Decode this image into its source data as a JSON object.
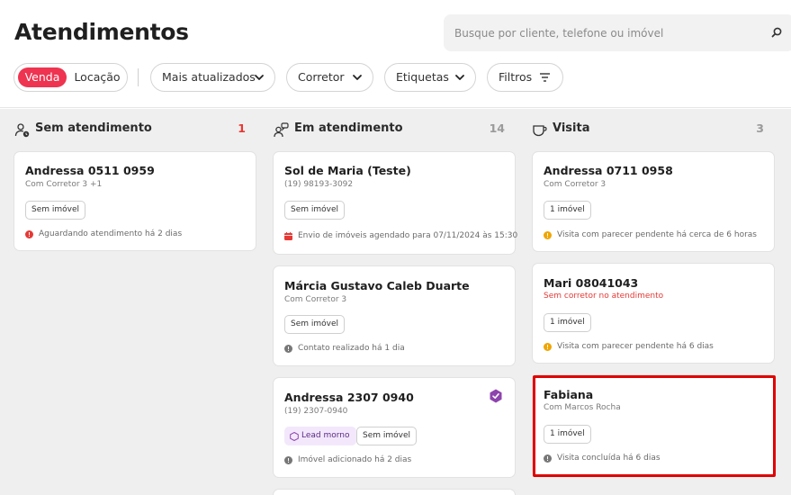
{
  "header": {
    "title": "Atendimentos",
    "search": {
      "placeholder": "Busque por cliente, telefone ou imóvel",
      "icon": "search-icon"
    },
    "mode_toggle": {
      "active": "Venda",
      "inactive": "Locação"
    },
    "filters": [
      {
        "label": "Mais atualizados",
        "icon": "chevron-down-icon"
      },
      {
        "label": "Corretor",
        "icon": "chevron-down-icon"
      },
      {
        "label": "Etiquetas",
        "icon": "chevron-down-icon"
      },
      {
        "label": "Filtros",
        "icon": "filter-lines-icon"
      }
    ]
  },
  "colors": {
    "accent": "#ee3450",
    "danger": "#e53935",
    "warning": "#f0a500",
    "muted": "#7a7a7a",
    "lead_bg": "#f3e8fb",
    "verified": "#8e44ad"
  },
  "columns": [
    {
      "title": "Sem atendimento",
      "count": "1",
      "icon": "person-clock-icon",
      "cards": [
        {
          "name": "Andressa 0511 0959",
          "subtitle": "Com Corretor 3 +1",
          "tags": [
            "Sem imóvel"
          ],
          "status": "Aguardando atendimento há 2 dias",
          "status_icon": "alert-circle-icon"
        }
      ]
    },
    {
      "title": "Em atendimento",
      "count": "14",
      "icon": "people-chat-icon",
      "cards": [
        {
          "name": "Sol de Maria (Teste)",
          "subtitle": "(19) 98193-3092",
          "tags": [
            "Sem imóvel"
          ],
          "status": "Envio de imóveis agendado para 07/11/2024 às 15:30",
          "status_icon": "calendar-icon"
        },
        {
          "name": "Márcia Gustavo Caleb Duarte",
          "subtitle": "Com Corretor 3",
          "tags": [
            "Sem imóvel"
          ],
          "status": "Contato realizado há 1 dia",
          "status_icon": "info-circle-icon"
        },
        {
          "name": "Andressa 2307 0940",
          "subtitle": "(19) 2307-0940",
          "lead_tag": "Lead morno",
          "tags": [
            "Sem imóvel"
          ],
          "status": "Imóvel adicionado há 2 dias",
          "status_icon": "info-circle-icon",
          "badge_icon": "verified-check-icon"
        }
      ]
    },
    {
      "title": "Visita",
      "count": "3",
      "icon": "cup-icon",
      "cards": [
        {
          "name": "Andressa 0711 0958",
          "subtitle": "Com Corretor 3",
          "tags": [
            "1 imóvel"
          ],
          "status": "Visita com parecer pendente há cerca de 6 horas",
          "status_icon": "warning-circle-icon"
        },
        {
          "name": "Mari 08041043",
          "subtitle": "Sem corretor no atendimento",
          "tags": [
            "1 imóvel"
          ],
          "status": "Visita com parecer pendente há 6 dias",
          "status_icon": "warning-circle-icon"
        },
        {
          "name": "Fabiana",
          "subtitle": "Com Marcos Rocha",
          "tags": [
            "1 imóvel"
          ],
          "status": "Visita concluída há 6 dias",
          "status_icon": "info-circle-icon"
        }
      ]
    }
  ]
}
